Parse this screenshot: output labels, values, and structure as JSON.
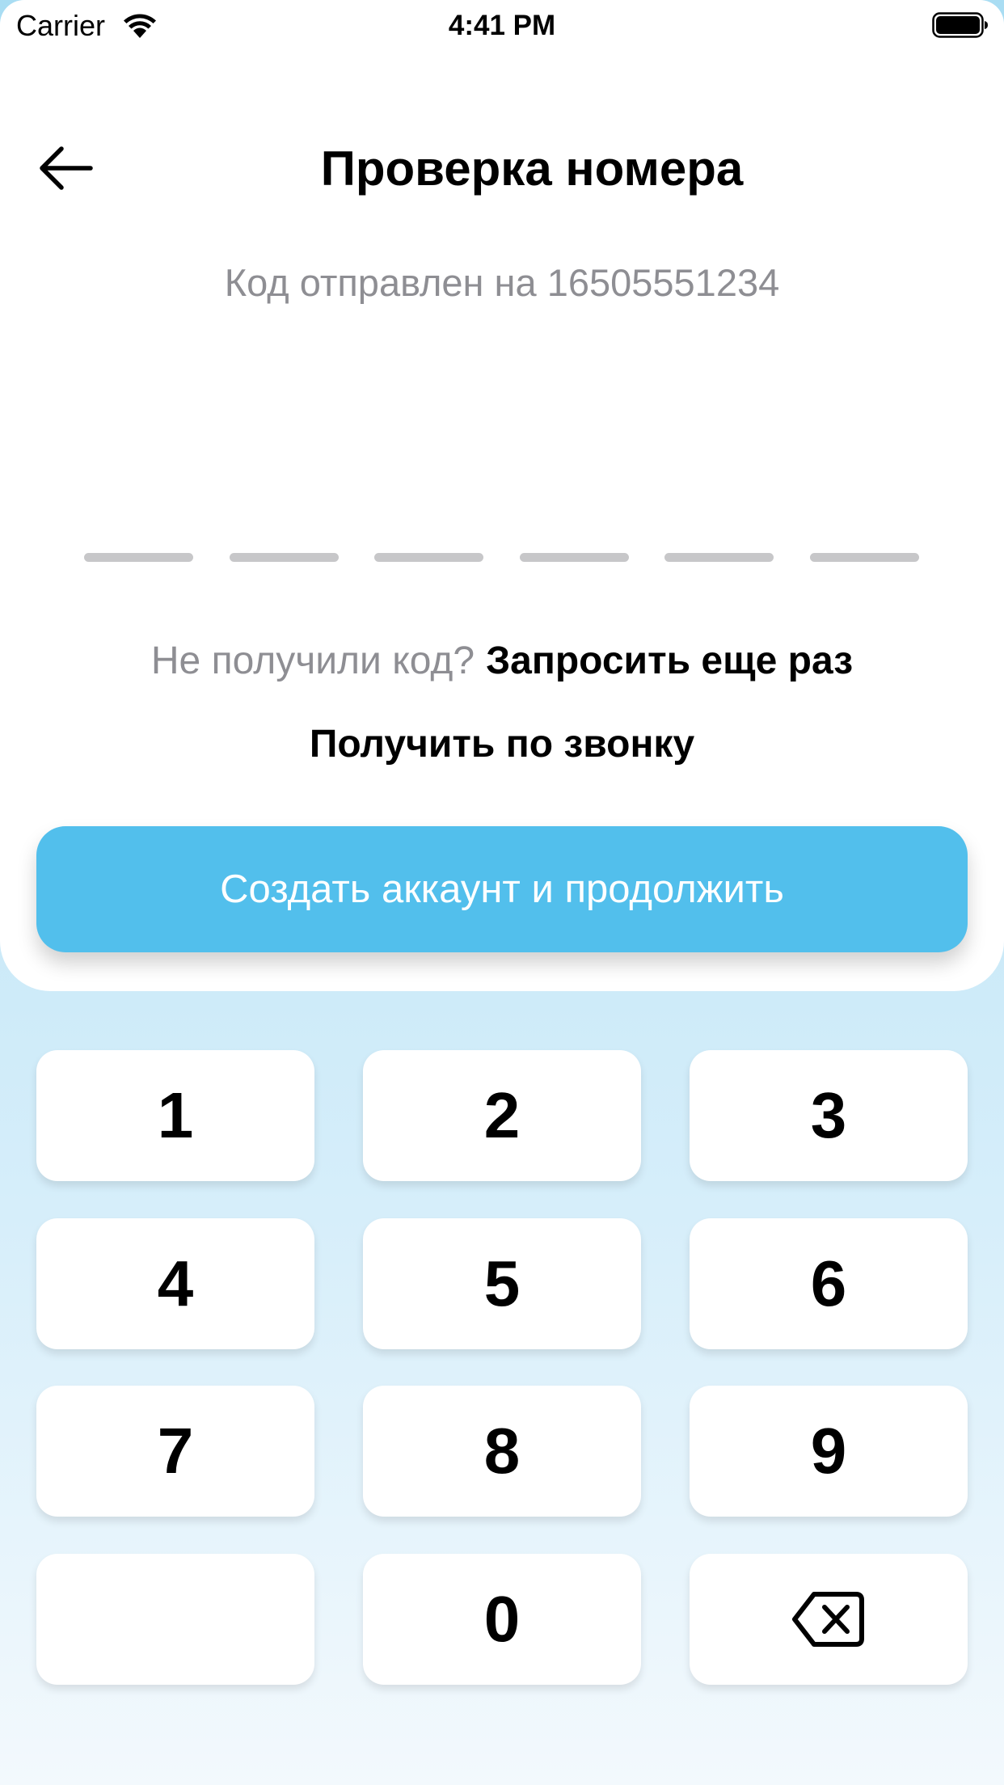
{
  "status_bar": {
    "carrier": "Carrier",
    "time": "4:41 PM",
    "wifi_icon": "wifi-icon",
    "battery_icon": "battery-full-icon"
  },
  "header": {
    "back_icon": "arrow-left-icon",
    "title": "Проверка номера"
  },
  "subtitle": "Код отправлен на 16505551234",
  "code": {
    "length": 6,
    "slot_color": "#c7c7c9"
  },
  "resend": {
    "question": "Не получили код?",
    "link": "Запросить еще раз"
  },
  "call_link": "Получить по звонку",
  "primary_button": {
    "label": "Создать аккаунт и продолжить",
    "color": "#52bfec"
  },
  "keypad": {
    "keys": [
      "1",
      "2",
      "3",
      "4",
      "5",
      "6",
      "7",
      "8",
      "9",
      "",
      "0"
    ],
    "backspace_icon": "backspace-icon"
  },
  "colors": {
    "accent": "#52bfec",
    "keypad_background_top": "#a9ddf3",
    "keypad_background_bottom": "#f3f9fd",
    "secondary_text": "#8e8e93"
  }
}
